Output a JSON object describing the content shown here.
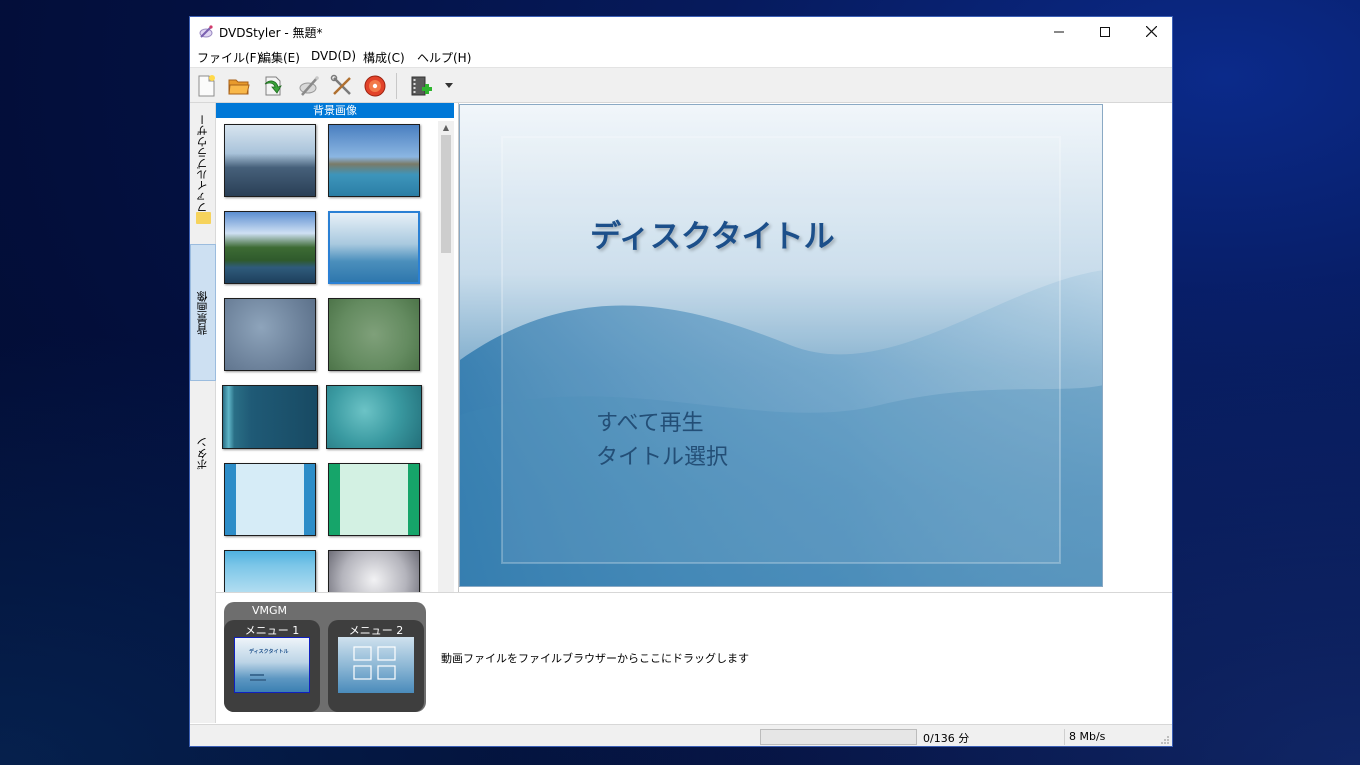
{
  "window": {
    "title": "DVDStyler - 無題*"
  },
  "menubar": [
    "ファイル(F)",
    "編集(E)",
    "DVD(D)",
    "構成(C)",
    "ヘルプ(H)"
  ],
  "toolbar": {
    "icons": [
      "new-file-icon",
      "open-folder-icon",
      "save-icon",
      "burn-wand-icon",
      "settings-tools-icon",
      "burn-dvd-icon",
      "add-video-icon"
    ]
  },
  "side_tabs": {
    "file_browser": "ファイルブラウザー",
    "backgrounds": "背景画像",
    "buttons": "ボタン"
  },
  "background_panel": {
    "header": "背景画像",
    "thumbnails": [
      "sea-sky",
      "ship-coast",
      "lake-forest",
      "blue-wave",
      "gray-blue-cloud",
      "green-cloud",
      "teal-stripes",
      "teal-water",
      "blue-frame",
      "green-frame",
      "light-blue-frame",
      "gray-frame"
    ]
  },
  "preview": {
    "disc_title": "ディスクタイトル",
    "buttons": [
      "すべて再生",
      "タイトル選択"
    ]
  },
  "menus_panel": {
    "vmgm_label": "VMGM",
    "menus": [
      "メニュー 1",
      "メニュー 2"
    ],
    "mini_title": "ディスクタイトル",
    "drag_hint": "動画ファイルをファイルブラウザーからここにドラッグします"
  },
  "status": {
    "progress": 0,
    "duration": "0/136 分",
    "bitrate": "8 Mb/s"
  },
  "colors": {
    "accent": "#0078d7",
    "title_blue": "#1c4f8a"
  }
}
